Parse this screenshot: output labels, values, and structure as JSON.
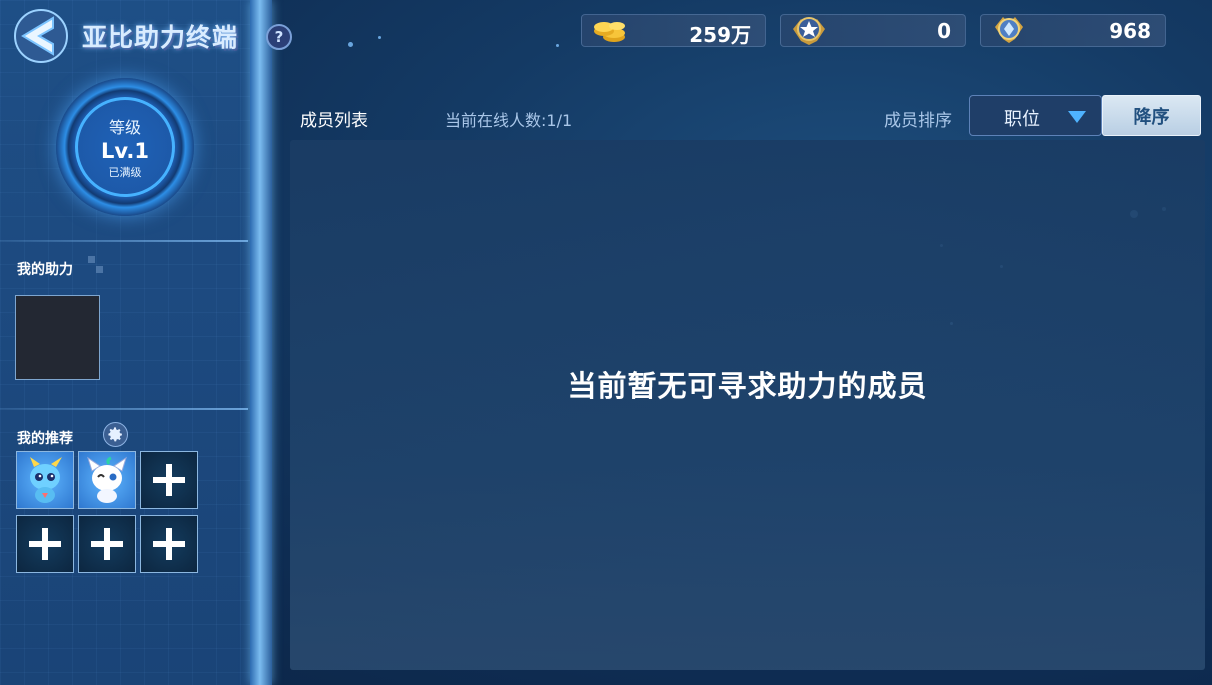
{
  "header": {
    "title": "亚比助力终端",
    "help_label": "?"
  },
  "resources": [
    {
      "name": "gold",
      "icon": "coins-icon",
      "value": "259万"
    },
    {
      "name": "badge",
      "icon": "star-medal-icon",
      "value": "0"
    },
    {
      "name": "honor",
      "icon": "medal-icon",
      "value": "968"
    }
  ],
  "level": {
    "label": "等级",
    "value": "Lv.1",
    "status": "已满级"
  },
  "my_assist": {
    "title": "我的助力"
  },
  "my_recommend": {
    "title": "我的推荐",
    "slots": [
      "pet-blue",
      "pet-white",
      "empty",
      "empty",
      "empty",
      "empty"
    ]
  },
  "member_list": {
    "title": "成员列表",
    "online": "当前在线人数:1/1",
    "sort_label": "成员排序",
    "sort_value": "职位",
    "order_button": "降序",
    "empty_message": "当前暂无可寻求助力的成员"
  },
  "colors": {
    "accent": "#46b2ff",
    "panel": "#1a3c64",
    "button_light": "#c8dcee"
  }
}
